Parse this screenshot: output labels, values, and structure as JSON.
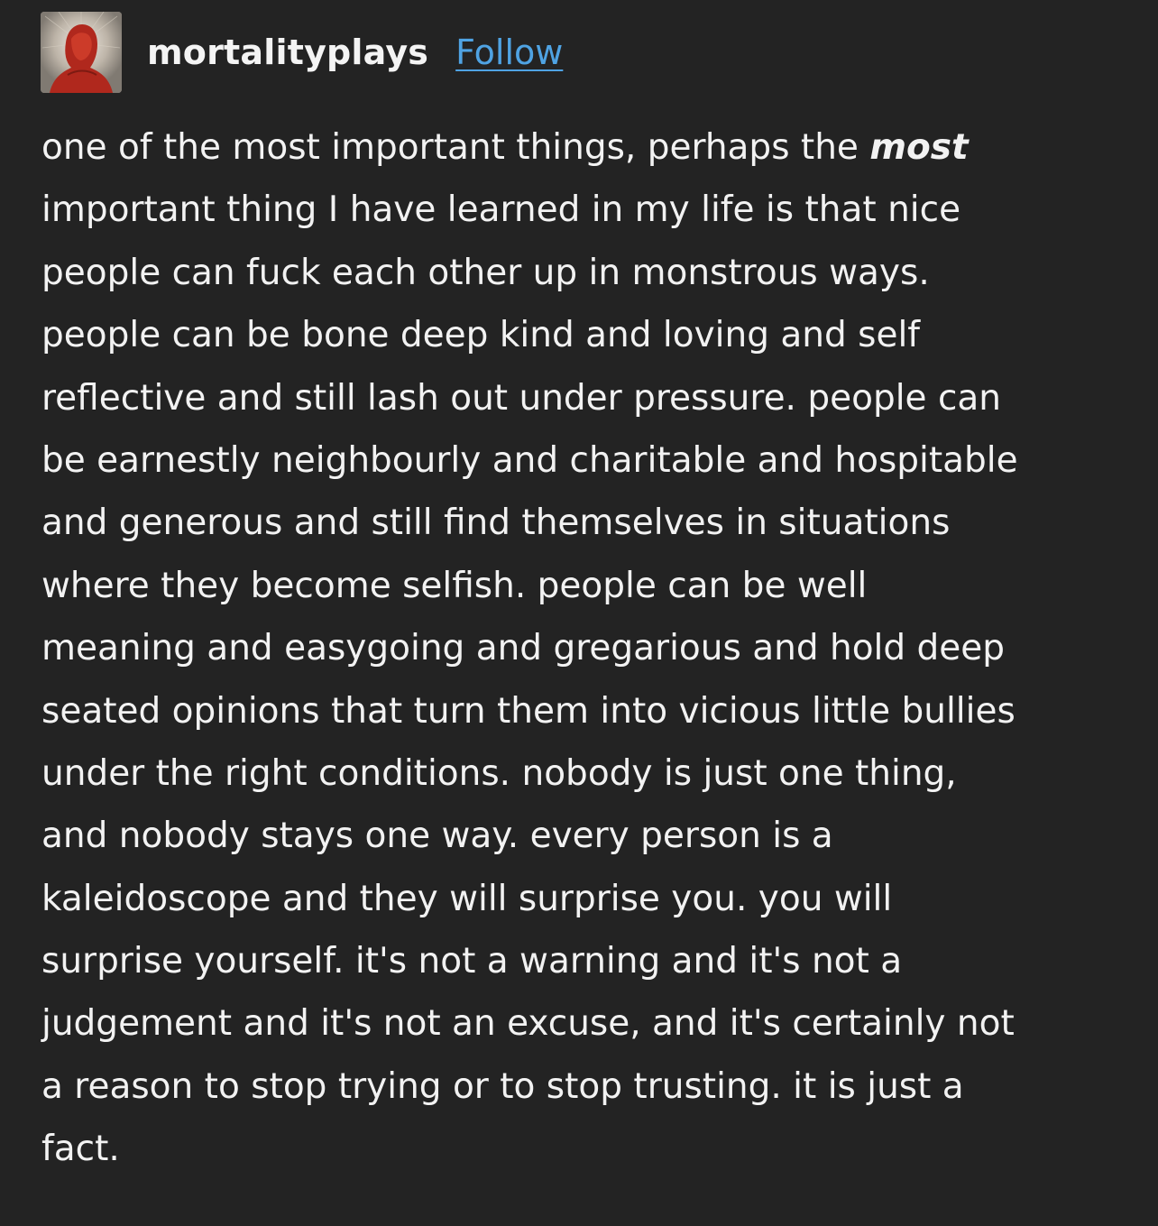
{
  "post": {
    "username": "mortalityplays",
    "follow_label": "Follow",
    "avatar_icon": "red-figure-avatar",
    "colors": {
      "background": "#232323",
      "text": "#f2f2f2",
      "link": "#4fa3e3"
    },
    "body": {
      "line1_pre": "one of the most important things, perhaps the ",
      "line1_emphasis": "most",
      "lines": [
        "important thing I have learned in my life is that nice",
        "people can fuck each other up in monstrous ways.",
        "people can be bone deep kind and loving and self",
        "reflective and still lash out under pressure. people can",
        "be earnestly neighbourly and charitable and hospitable",
        "and generous and still find themselves in situations",
        "where they become selfish. people can be well",
        "meaning and easygoing and gregarious and hold deep",
        "seated opinions that turn them into vicious little bullies",
        "under the right conditions. nobody is just one thing,",
        "and nobody stays one way. every person is a",
        "kaleidoscope and they will surprise you. you will",
        "surprise yourself. it's not a warning and it's not a",
        "judgement and it's not an excuse, and it's certainly not",
        "a reason to stop trying or to stop trusting. it is just a",
        "fact."
      ]
    }
  }
}
